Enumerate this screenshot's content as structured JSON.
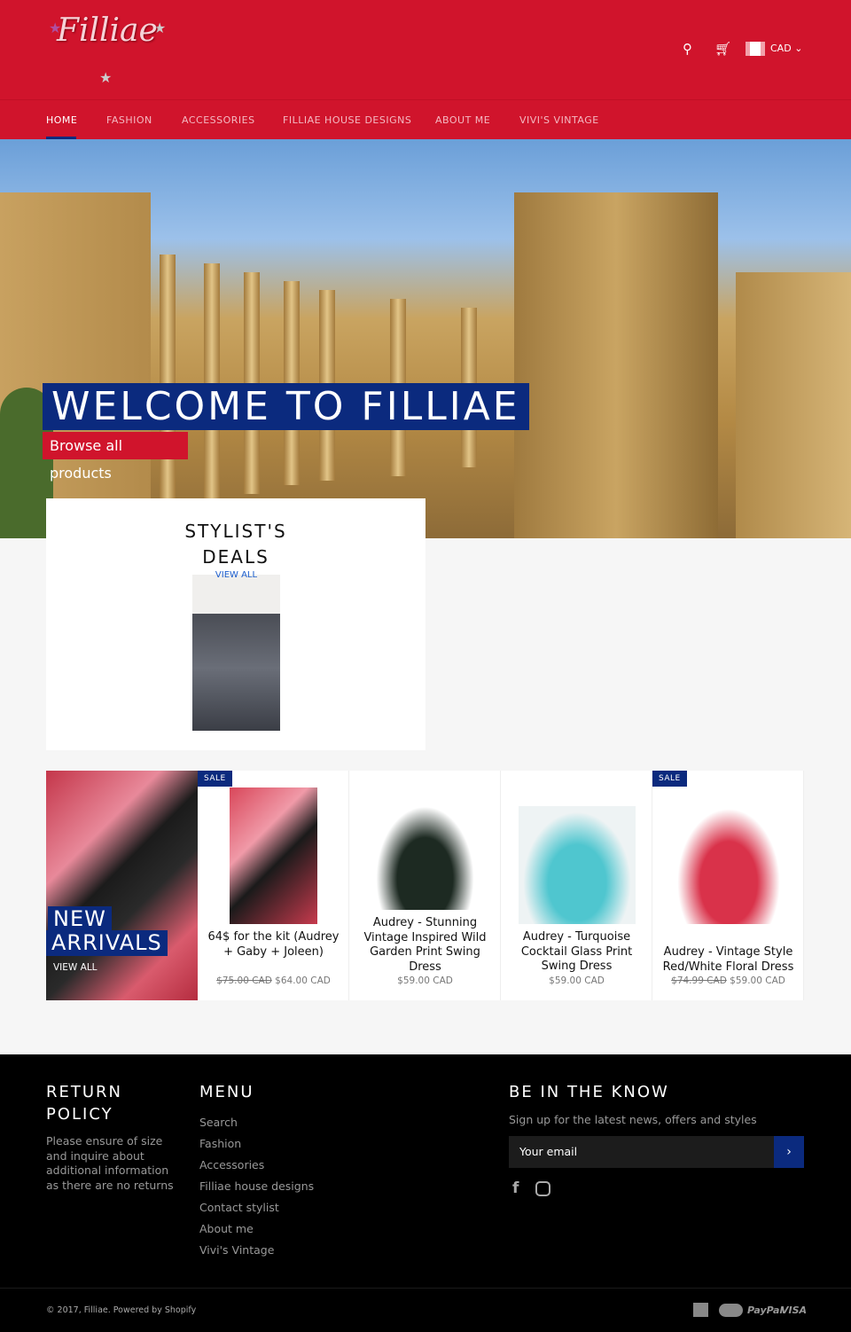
{
  "header": {
    "logo_text": "Filliae",
    "currency": "CAD",
    "icons": [
      "search-icon",
      "cart-icon",
      "canada-flag-icon",
      "chevron-down-icon"
    ]
  },
  "nav": {
    "items": [
      {
        "label": "HOME",
        "active": true
      },
      {
        "label": "FASHION"
      },
      {
        "label": "ACCESSORIES"
      },
      {
        "label": "FILLIAE HOUSE DESIGNS"
      },
      {
        "label": "ABOUT ME"
      },
      {
        "label": "VIVI'S VINTAGE"
      }
    ]
  },
  "hero": {
    "title": "WELCOME TO FILLIAE",
    "button": "Browse all products"
  },
  "stylist": {
    "title_line1": "STYLIST'S",
    "title_line2": "DEALS",
    "view_all": "VIEW ALL"
  },
  "new_arrivals": {
    "line1": "NEW",
    "line2": "ARRIVALS",
    "view_all": "VIEW ALL"
  },
  "products": [
    {
      "title": "64$ for the kit (Audrey + Gaby + Joleen)",
      "old_price": "$75.00 CAD",
      "price": "$64.00 CAD",
      "badge": "SALE"
    },
    {
      "title": "Audrey - Stunning Vintage Inspired Wild Garden Print Swing Dress",
      "price": "$59.00 CAD"
    },
    {
      "title": "Audrey - Turquoise Cocktail Glass Print Swing Dress",
      "price": "$59.00 CAD"
    },
    {
      "title": "Audrey - Vintage Style Red/White Floral Dress",
      "old_price": "$74.99 CAD",
      "price": "$59.00 CAD",
      "badge": "SALE"
    }
  ],
  "footer": {
    "return_title1": "RETURN",
    "return_title2": "POLICY",
    "return_text": "Please ensure of size and inquire about additional information as there are no returns",
    "menu_title": "MENU",
    "menu": [
      "Search",
      "Fashion",
      "Accessories",
      "Filliae house designs",
      "Contact stylist",
      "About me",
      "Vivi's Vintage"
    ],
    "know_title": "BE IN THE KNOW",
    "know_text": "Sign up for the latest news, offers and styles",
    "email_placeholder": "Your email",
    "social": [
      "facebook-icon",
      "instagram-icon"
    ],
    "copyright": "© 2017, Filliae. Powered by Shopify",
    "payments": [
      "American Express",
      "MasterCard",
      "PayPal",
      "VISA"
    ]
  },
  "colors": {
    "brand_red": "#d0142c",
    "navy": "#0b2a7e"
  }
}
